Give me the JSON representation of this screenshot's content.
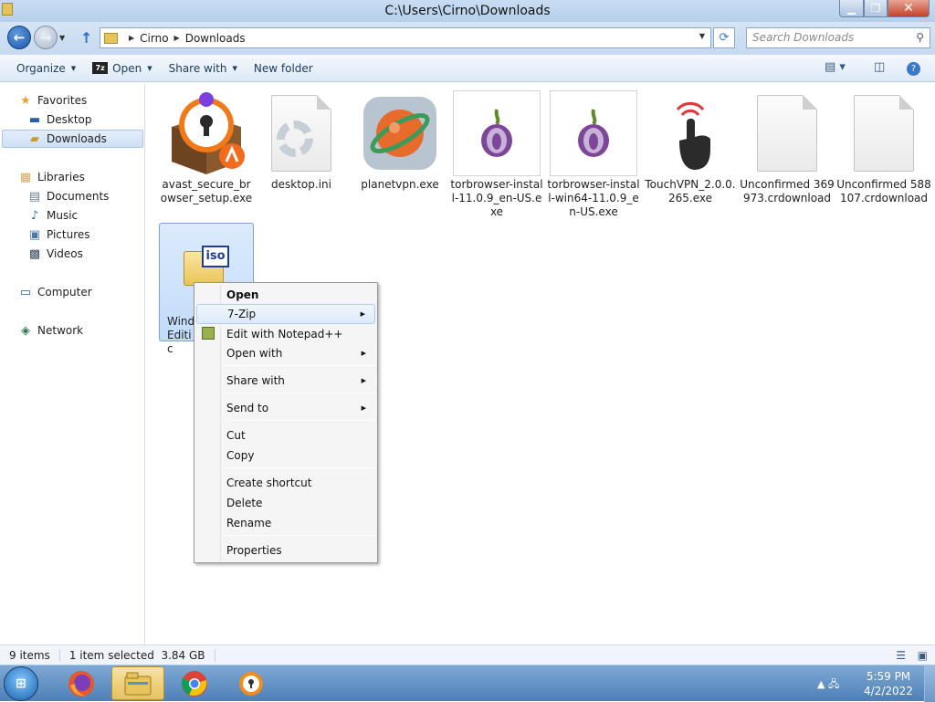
{
  "window": {
    "title": "C:\\Users\\Cirno\\Downloads"
  },
  "address": {
    "crumbs": [
      "Cirno",
      "Downloads"
    ],
    "search_placeholder": "Search Downloads"
  },
  "toolbar": {
    "organize": "Organize",
    "open": "Open",
    "open_icon_text": "7z",
    "share_with": "Share with",
    "new_folder": "New folder"
  },
  "nav": {
    "favorites": "Favorites",
    "desktop": "Desktop",
    "downloads": "Downloads",
    "libraries": "Libraries",
    "documents": "Documents",
    "music": "Music",
    "pictures": "Pictures",
    "videos": "Videos",
    "computer": "Computer",
    "network": "Network"
  },
  "files": [
    {
      "name": "avast_secure_browser_setup.exe",
      "icon": "avast-icon"
    },
    {
      "name": "desktop.ini",
      "icon": "settings-file-icon"
    },
    {
      "name": "planetvpn.exe",
      "icon": "planetvpn-icon"
    },
    {
      "name": "torbrowser-install-11.0.9_en-US.exe",
      "icon": "tor-onion-icon"
    },
    {
      "name": "torbrowser-install-win64-11.0.9_en-US.exe",
      "icon": "tor-onion-icon"
    },
    {
      "name": "TouchVPN_2.0.0.265.exe",
      "icon": "touch-hand-icon"
    },
    {
      "name": "Unconfirmed 369973.crdownload",
      "icon": "blank-document-icon"
    },
    {
      "name": "Unconfirmed 588107.crdownload",
      "icon": "blank-document-icon"
    }
  ],
  "selected_file": {
    "name_line1": "Wind",
    "name_line2": "Editic",
    "icon_text": "iso"
  },
  "context_menu": {
    "open": "Open",
    "seven_zip": "7-Zip",
    "edit_notepad": "Edit with Notepad++",
    "open_with": "Open with",
    "share_with": "Share with",
    "send_to": "Send to",
    "cut": "Cut",
    "copy": "Copy",
    "create_shortcut": "Create shortcut",
    "delete": "Delete",
    "rename": "Rename",
    "properties": "Properties"
  },
  "status": {
    "items": "9 items",
    "selected": "1 item selected  3.84 GB"
  },
  "clock": {
    "time": "5:59 PM",
    "date": "4/2/2022"
  }
}
